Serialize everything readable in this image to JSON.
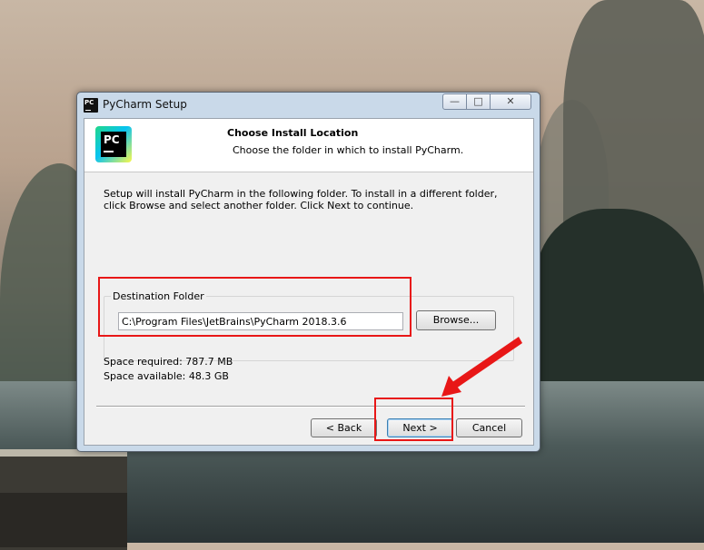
{
  "window": {
    "title": "PyCharm Setup",
    "app_icon_text": "PC"
  },
  "header": {
    "title": "Choose Install Location",
    "subtitle": "Choose the folder in which to install PyCharm.",
    "logo_text": "PC"
  },
  "body": {
    "intro": "Setup will install PyCharm in the following folder. To install in a different folder, click Browse and select another folder. Click Next to continue.",
    "destination_label": "Destination Folder",
    "destination_path": "C:\\Program Files\\JetBrains\\PyCharm 2018.3.6",
    "browse_label": "Browse...",
    "space_required": "Space required: 787.7 MB",
    "space_available": "Space available: 48.3 GB"
  },
  "buttons": {
    "back": "< Back",
    "next": "Next >",
    "cancel": "Cancel"
  },
  "colors": {
    "annotation": "#e81717",
    "logo_gradient": [
      "#21d789",
      "#07c3f2",
      "#fcf84a"
    ]
  },
  "icons": [
    "minimize-icon",
    "maximize-icon",
    "close-icon",
    "pycharm-logo"
  ]
}
